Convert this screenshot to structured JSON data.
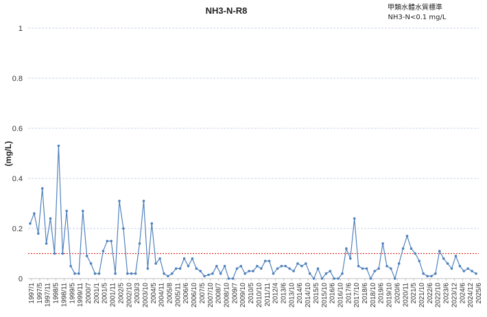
{
  "chart_data": {
    "type": "line",
    "title": "NH3-N-R8",
    "annotation_lines": [
      "甲類水體水質標準",
      "NH3-N<0.1 mg/L"
    ],
    "ylabel": "(mg/L)",
    "xlabel": "",
    "ylim": [
      0,
      1
    ],
    "yticks": [
      0,
      0.2,
      0.4,
      0.6,
      0.8,
      1
    ],
    "grid": true,
    "reference_line": {
      "value": 0.1,
      "color": "#e0302a"
    },
    "series_color": "#4f81bd",
    "x_tick_labels": [
      "1997/1",
      "1997/5",
      "1997/11",
      "1998/5",
      "1998/11",
      "1999/5",
      "1999/11",
      "2000/7",
      "2001/1",
      "2001/5",
      "2001/11",
      "2002/5",
      "2002/10",
      "2003/3",
      "2003/10",
      "2004/5",
      "2004/11",
      "2005/8",
      "2005/11",
      "2006/6",
      "2006/10",
      "2007/5",
      "2007/10",
      "2008/7",
      "2008/10",
      "2009/7",
      "2009/10",
      "2010/5",
      "2010/10",
      "2011/11",
      "2012/4",
      "2013/6",
      "2013/10",
      "2014/6",
      "2014/10",
      "2015/5",
      "2015/10",
      "2016/6",
      "2016/10",
      "2017/6",
      "2017/10",
      "2018/6",
      "2018/10",
      "2019/6",
      "2019/10",
      "2020/6",
      "2020/11",
      "2021/5",
      "2021/10",
      "2022/6",
      "2022/10",
      "2023/6",
      "2023/12",
      "2024/6",
      "2024/12",
      "2025/6"
    ],
    "values": [
      0.22,
      0.26,
      0.18,
      0.36,
      0.14,
      0.24,
      0.1,
      0.53,
      0.1,
      0.27,
      0.05,
      0.02,
      0.02,
      0.27,
      0.09,
      0.06,
      0.02,
      0.02,
      0.11,
      0.15,
      0.15,
      0.02,
      0.31,
      0.2,
      0.02,
      0.02,
      0.02,
      0.14,
      0.31,
      0.04,
      0.22,
      0.06,
      0.08,
      0.02,
      0.01,
      0.02,
      0.04,
      0.04,
      0.08,
      0.05,
      0.08,
      0.04,
      0.03,
      0.01,
      0.015,
      0.02,
      0.05,
      0.02,
      0.05,
      0.0,
      0.0,
      0.04,
      0.05,
      0.02,
      0.03,
      0.03,
      0.05,
      0.04,
      0.07,
      0.07,
      0.02,
      0.04,
      0.05,
      0.05,
      0.04,
      0.03,
      0.06,
      0.05,
      0.06,
      0.02,
      0.0,
      0.04,
      0.0,
      0.02,
      0.03,
      0.0,
      0.0,
      0.02,
      0.12,
      0.08,
      0.24,
      0.05,
      0.04,
      0.04,
      0.0,
      0.03,
      0.04,
      0.14,
      0.05,
      0.04,
      0.0,
      0.06,
      0.12,
      0.17,
      0.12,
      0.1,
      0.07,
      0.02,
      0.01,
      0.01,
      0.02,
      0.11,
      0.08,
      0.06,
      0.04,
      0.09,
      0.05,
      0.03,
      0.04,
      0.03,
      0.02
    ]
  }
}
